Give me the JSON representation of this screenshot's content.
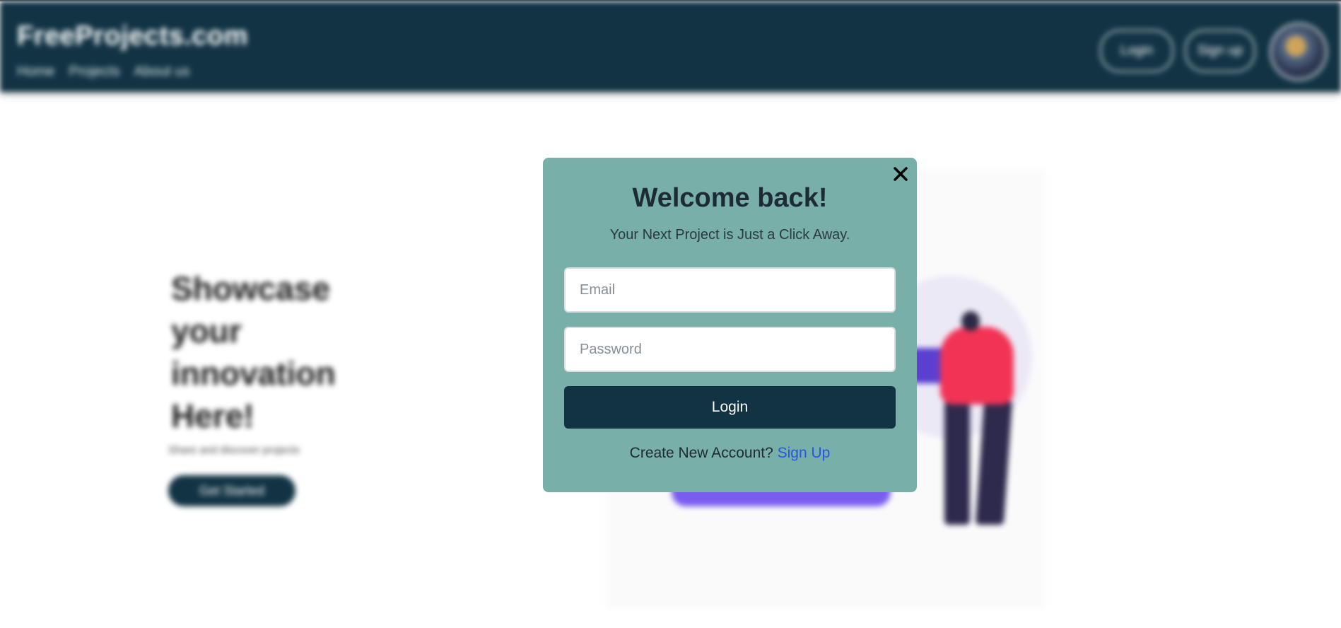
{
  "navbar": {
    "brand": "FreeProjects.com",
    "links": [
      "Home",
      "Projects",
      "About us"
    ],
    "login_label": "Login",
    "signup_label": "Sign up"
  },
  "hero": {
    "title": "Showcase your innovation Here!",
    "subtitle": "Share and discover projects",
    "cta_label": "Get Started"
  },
  "modal": {
    "title": "Welcome back!",
    "subtitle": "Your Next Project is Just a Click Away.",
    "email_placeholder": "Email",
    "password_placeholder": "Password",
    "login_label": "Login",
    "create_text": "Create New Account?",
    "signup_link": "Sign Up"
  },
  "colors": {
    "navbar": "#113344",
    "modal_bg": "#78afa9",
    "button": "#113344",
    "link": "#2458e0"
  },
  "icons": {
    "close": "close-icon"
  }
}
